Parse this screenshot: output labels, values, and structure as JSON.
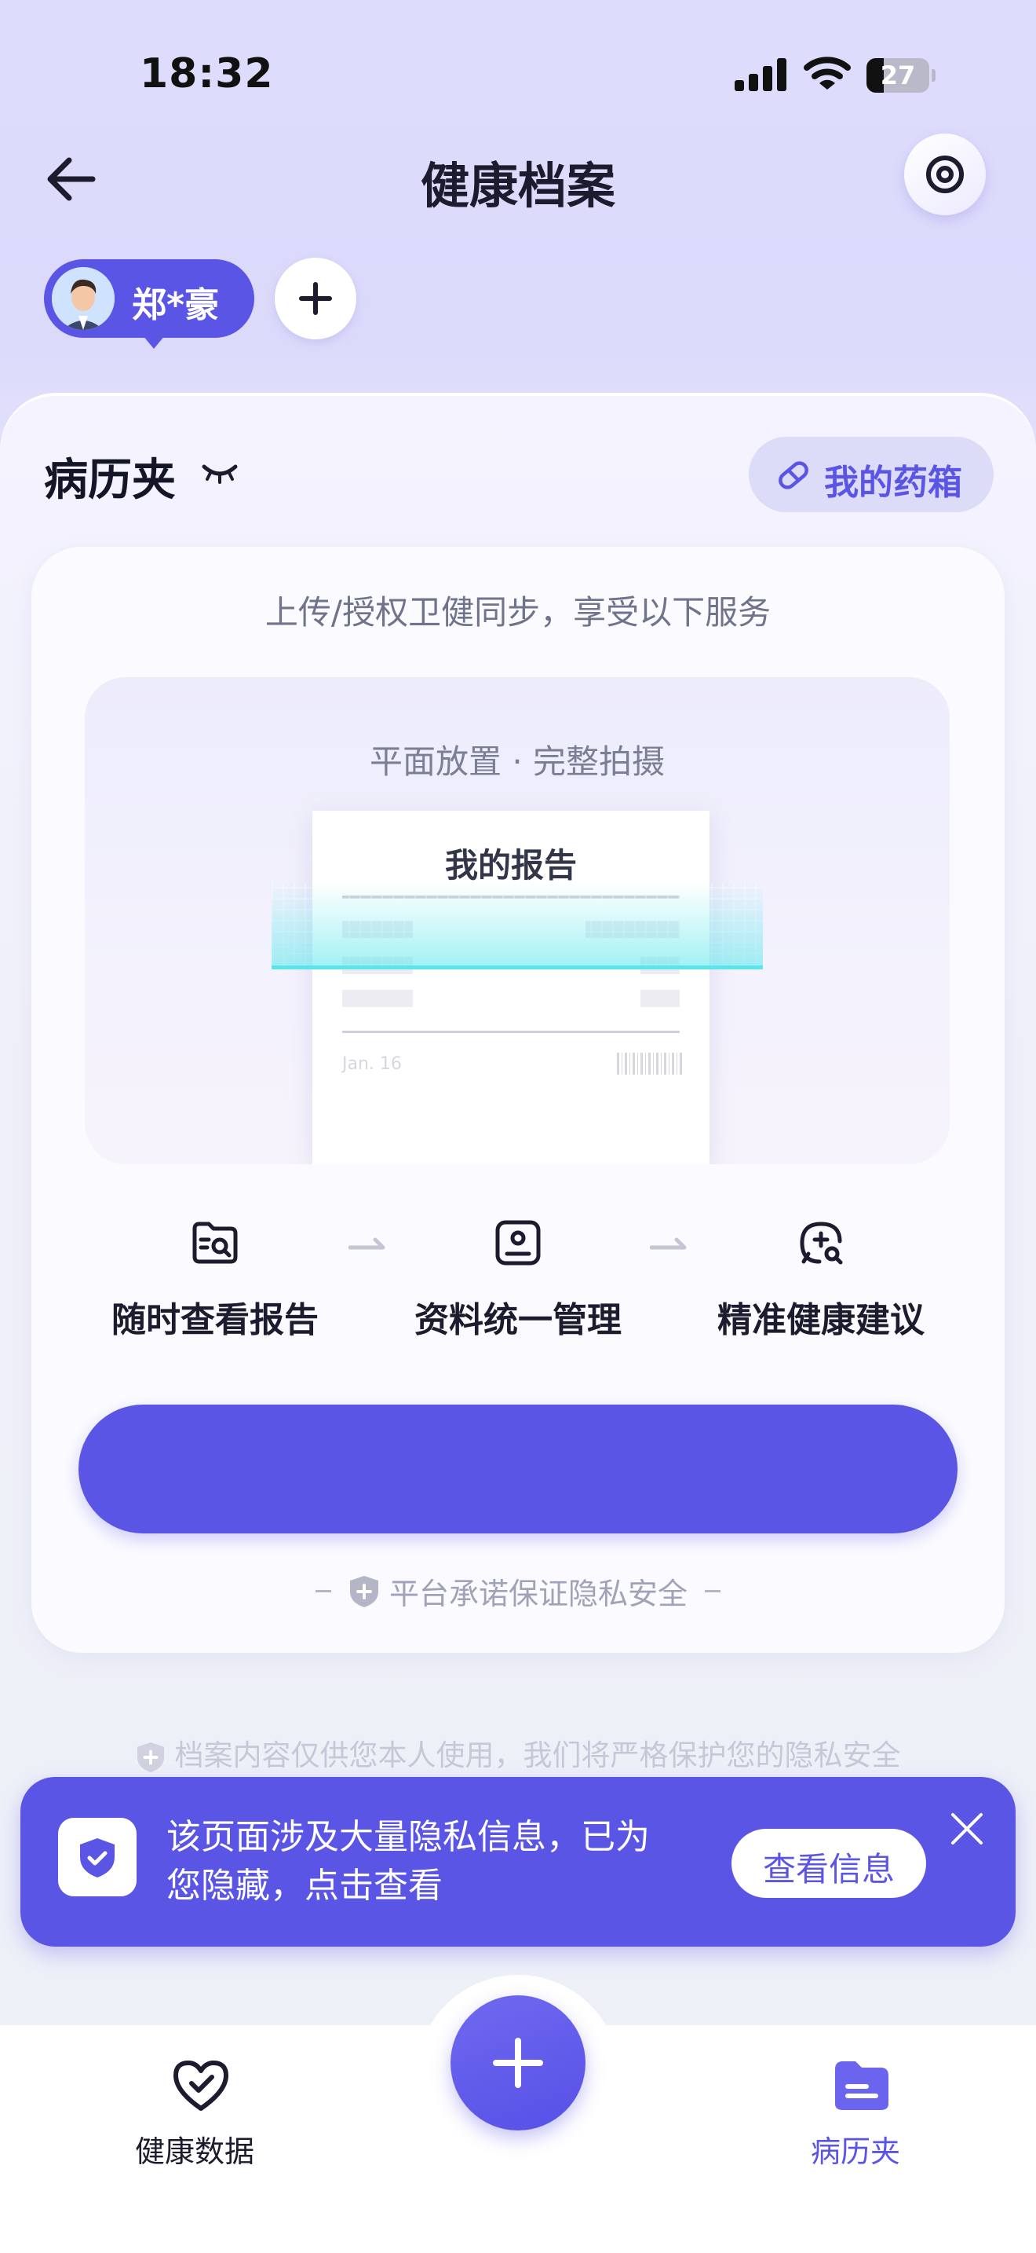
{
  "status_bar": {
    "time": "18:32",
    "battery": "27",
    "battery_level": 0.27
  },
  "header": {
    "title": "健康档案"
  },
  "profile": {
    "name": "郑*豪"
  },
  "section": {
    "title": "病历夹",
    "medicine_box_label": "我的药箱"
  },
  "upload_card": {
    "subtitle": "上传/授权卫健同步，享受以下服务",
    "illustration": {
      "hint": "平面放置 · 完整拍摄",
      "report_title": "我的报告",
      "report_date": "Jan. 16"
    },
    "features": [
      {
        "label": "随时查看报告",
        "icon": "folder-search-icon"
      },
      {
        "label": "资料统一管理",
        "icon": "profile-card-icon"
      },
      {
        "label": "精准健康建议",
        "icon": "chat-add-icon"
      }
    ],
    "primary_button_label": "",
    "privacy_promise": "平台承诺保证隐私安全"
  },
  "footer_note": "档案内容仅供您本人使用，我们将严格保护您的隐私安全",
  "privacy_banner": {
    "line1": "该页面涉及大量隐私信息，已为",
    "line2": "您隐藏，点击查看",
    "button_label": "查看信息"
  },
  "bottom_nav": {
    "items": [
      {
        "label": "健康数据",
        "icon": "heart-check-icon",
        "active": false
      },
      {
        "label": "病历夹",
        "icon": "folder-icon",
        "active": true
      }
    ],
    "fab_icon": "plus-icon"
  },
  "colors": {
    "accent": "#5b55e6",
    "nav_active": "#5b55e6",
    "nav_inactive": "#1c1c2e"
  }
}
